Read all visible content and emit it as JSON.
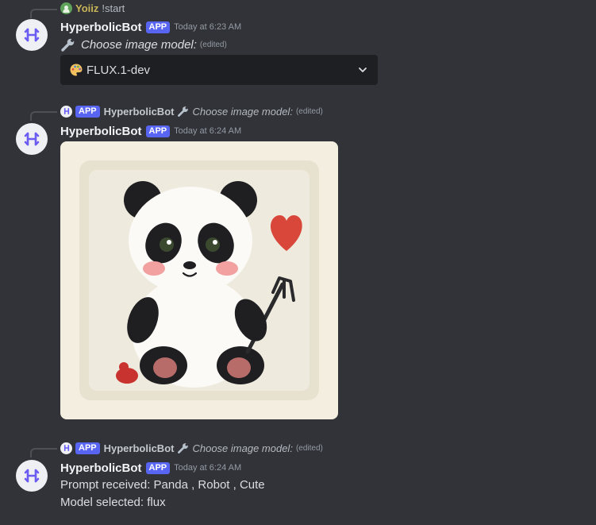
{
  "messages": [
    {
      "reply": {
        "author": "Yoiiz",
        "text": "!start"
      },
      "author": "HyperbolicBot",
      "badge": "APP",
      "timestamp": "Today at 6:23 AM",
      "content": "Choose image model:",
      "edited": "(edited)",
      "select": {
        "emoji_icon": "palette-icon",
        "value": "FLUX.1-dev"
      }
    },
    {
      "reply": {
        "badge": "APP",
        "author": "HyperbolicBot",
        "text": "Choose image model:",
        "edited": "(edited)"
      },
      "author": "HyperbolicBot",
      "badge": "APP",
      "timestamp": "Today at 6:24 AM",
      "image": {
        "subject": "cute panda holding a pitchfork with a red heart"
      }
    },
    {
      "reply": {
        "badge": "APP",
        "author": "HyperbolicBot",
        "text": "Choose image model:",
        "edited": "(edited)"
      },
      "author": "HyperbolicBot",
      "badge": "APP",
      "timestamp": "Today at 6:24 AM",
      "lines": [
        "Prompt received: Panda , Robot , Cute",
        "Model selected: flux"
      ]
    }
  ],
  "colors": {
    "background": "#313338",
    "badge": "#5865f2",
    "select_bg": "#1e1f22"
  }
}
